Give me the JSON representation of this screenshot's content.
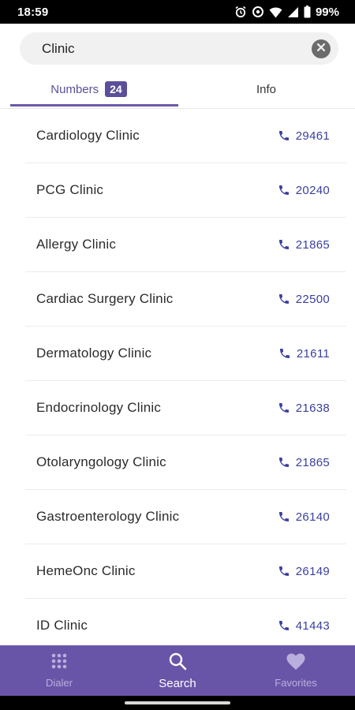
{
  "status_bar": {
    "time": "18:59",
    "battery_percent": "99%",
    "icons": [
      "alarm-icon",
      "data-saver-icon",
      "wifi-icon",
      "signal-icon",
      "battery-icon"
    ]
  },
  "search": {
    "value": "Clinic",
    "placeholder": "",
    "clear_icon": "clear-icon"
  },
  "tabs": [
    {
      "label": "Numbers",
      "badge": "24",
      "active": true
    },
    {
      "label": "Info",
      "active": false
    }
  ],
  "results": [
    {
      "name": "Cardiology Clinic",
      "number": "29461"
    },
    {
      "name": "PCG Clinic",
      "number": "20240"
    },
    {
      "name": "Allergy Clinic",
      "number": "21865"
    },
    {
      "name": "Cardiac Surgery Clinic",
      "number": "22500"
    },
    {
      "name": "Dermatology Clinic",
      "number": "21611"
    },
    {
      "name": "Endocrinology Clinic",
      "number": "21638"
    },
    {
      "name": "Otolaryngology Clinic",
      "number": "21865"
    },
    {
      "name": "Gastroenterology Clinic",
      "number": "26140"
    },
    {
      "name": "HemeOnc Clinic",
      "number": "26149"
    },
    {
      "name": "ID Clinic",
      "number": "41443"
    }
  ],
  "bottom_nav": [
    {
      "label": "Dialer",
      "icon": "dialpad-icon",
      "active": false
    },
    {
      "label": "Search",
      "icon": "search-icon",
      "active": true
    },
    {
      "label": "Favorites",
      "icon": "heart-icon",
      "active": false
    }
  ],
  "colors": {
    "accent": "#6955a8",
    "phone_link": "#3a3fa0",
    "tab_active": "#5b4f9a"
  }
}
